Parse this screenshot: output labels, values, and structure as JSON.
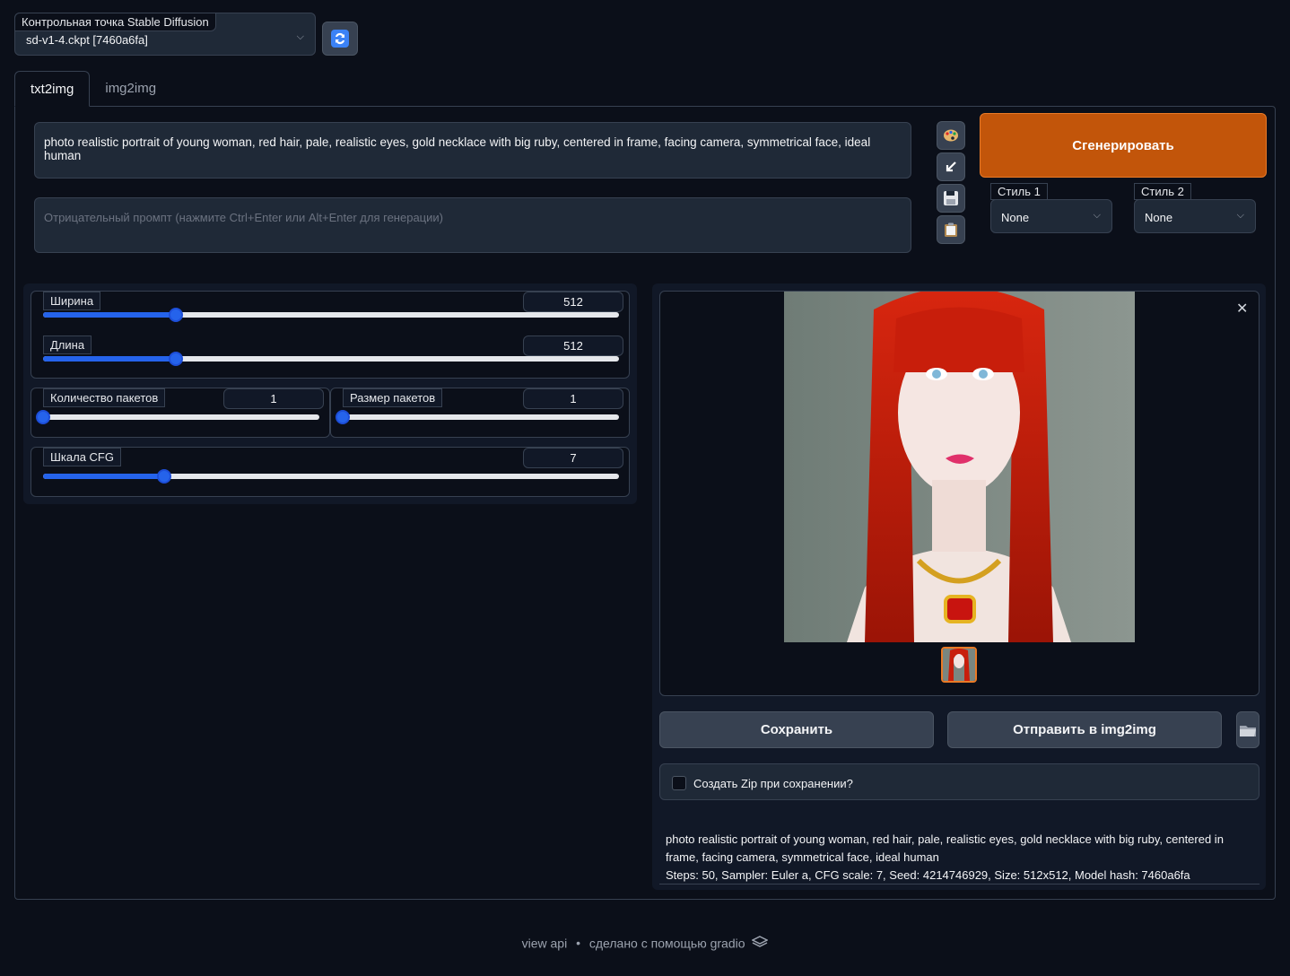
{
  "checkpoint": {
    "label": "Контрольная точка Stable Diffusion",
    "value": "sd-v1-4.ckpt [7460a6fa]"
  },
  "tabs": [
    {
      "label": "txt2img",
      "active": true
    },
    {
      "label": "img2img",
      "active": false
    }
  ],
  "prompt": {
    "value": "photo realistic portrait of young woman, red hair, pale, realistic eyes, gold necklace with big ruby, centered in frame, facing camera, symmetrical face, ideal human"
  },
  "negative_prompt": {
    "placeholder": "Отрицательный промпт (нажмите Ctrl+Enter или Alt+Enter для генерации)"
  },
  "generate_label": "Сгенерировать",
  "styles": [
    {
      "label": "Стиль 1",
      "value": "None"
    },
    {
      "label": "Стиль 2",
      "value": "None"
    }
  ],
  "sliders": {
    "width": {
      "label": "Ширина",
      "value": "512",
      "fraction": 0.23
    },
    "height": {
      "label": "Длина",
      "value": "512",
      "fraction": 0.23
    },
    "batch_count": {
      "label": "Количество пакетов",
      "value": "1",
      "fraction": 0.0
    },
    "batch_size": {
      "label": "Размер пакетов",
      "value": "1",
      "fraction": 0.0
    },
    "cfg": {
      "label": "Шкала CFG",
      "value": "7",
      "fraction": 0.21
    }
  },
  "output": {
    "save_label": "Сохранить",
    "send_label": "Отправить в img2img",
    "zip_label": "Создать Zip при сохранении?",
    "info_prompt": "photo realistic portrait of young woman, red hair, pale, realistic eyes, gold necklace with big ruby, centered in frame, facing camera, symmetrical face, ideal human",
    "info_params": "Steps: 50, Sampler: Euler a, CFG scale: 7, Seed: 4214746929, Size: 512x512, Model hash: 7460a6fa"
  },
  "footer": {
    "api": "view api",
    "sep": "•",
    "made_with": "сделано с помощью gradio"
  },
  "colors": {
    "accent": "#c2550a",
    "slider": "#2563eb",
    "background": "#0b0f19"
  }
}
